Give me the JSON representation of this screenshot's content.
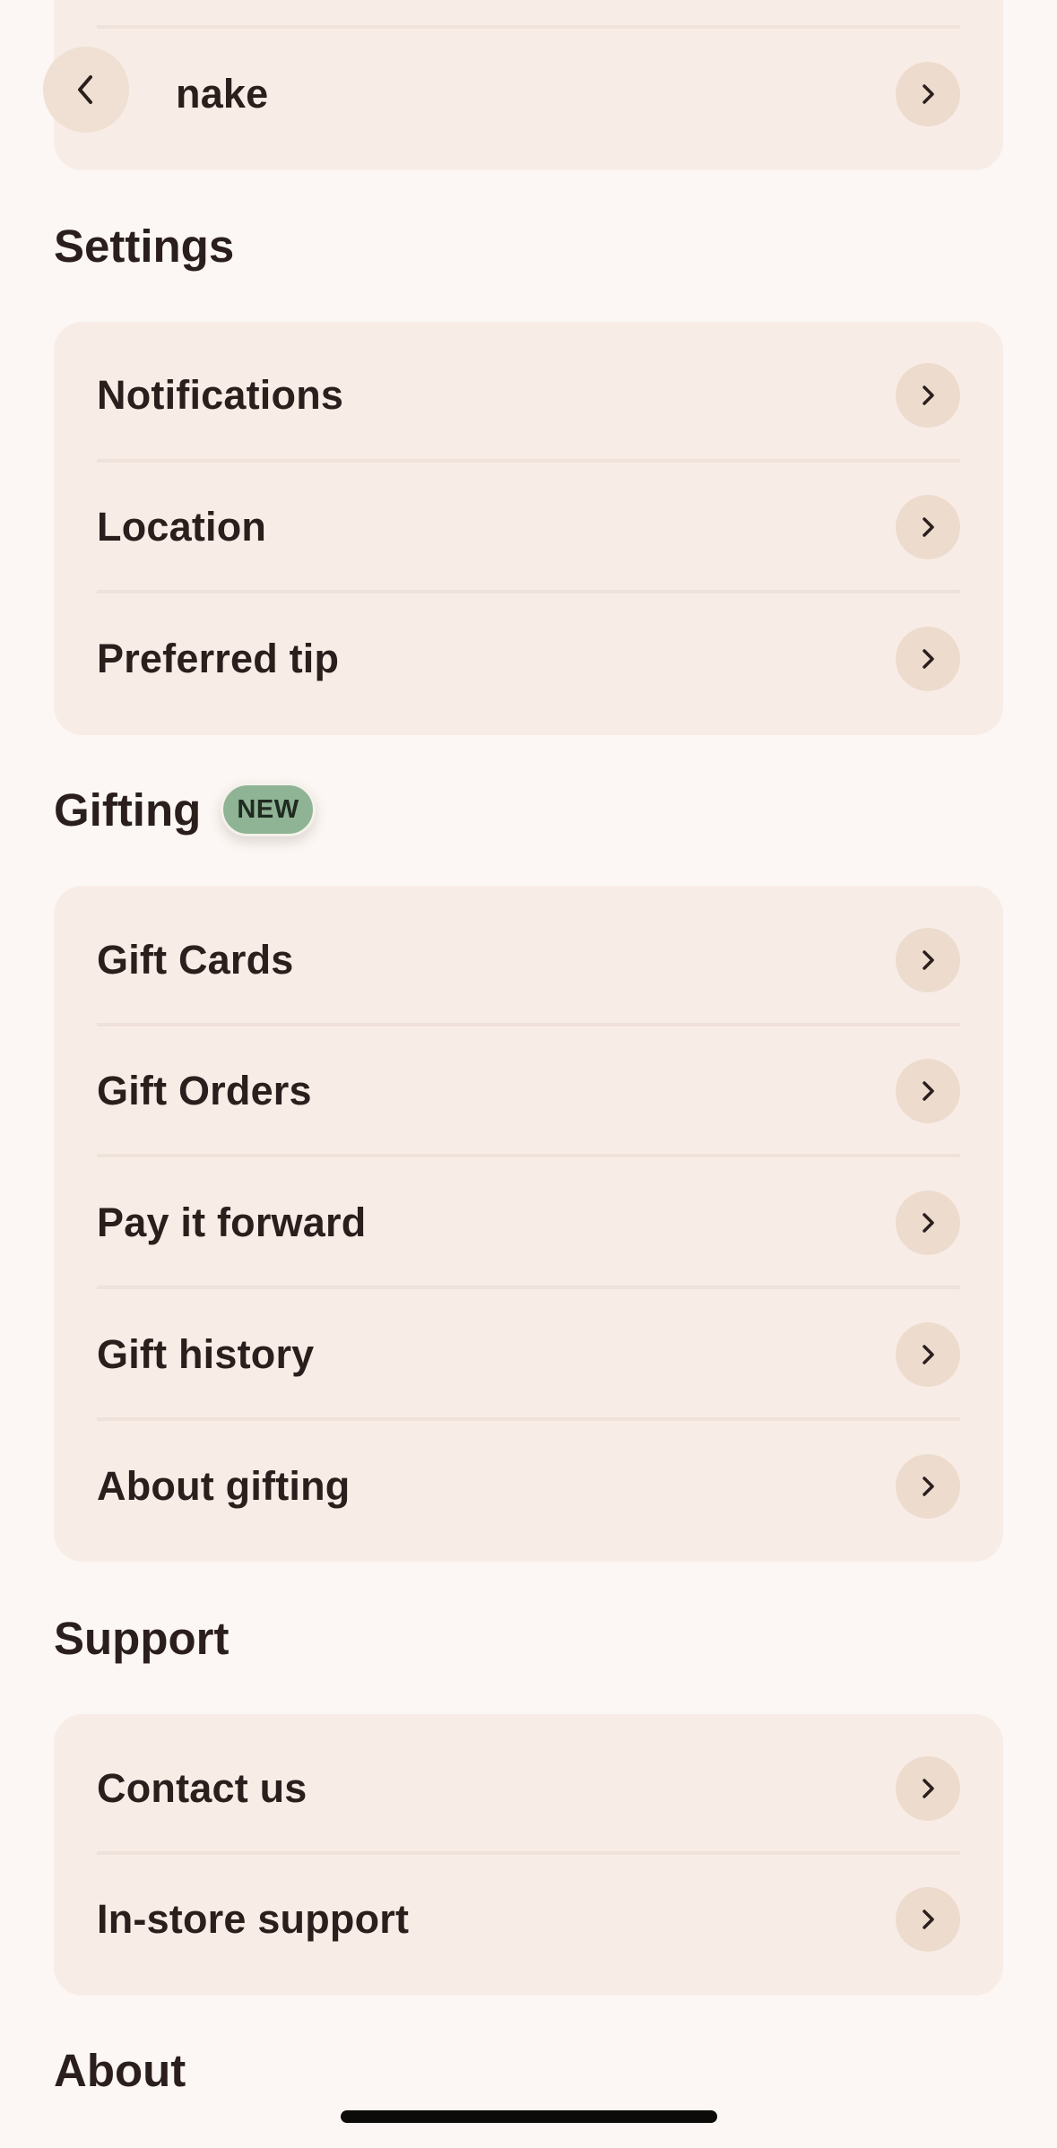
{
  "top_card": {
    "partial_label": "nake"
  },
  "settings": {
    "title": "Settings",
    "items": [
      {
        "label": "Notifications"
      },
      {
        "label": "Location"
      },
      {
        "label": "Preferred tip"
      }
    ]
  },
  "gifting": {
    "title": "Gifting",
    "badge": "NEW",
    "items": [
      {
        "label": "Gift Cards"
      },
      {
        "label": "Gift Orders"
      },
      {
        "label": "Pay it forward"
      },
      {
        "label": "Gift history"
      },
      {
        "label": "About gifting"
      }
    ]
  },
  "support": {
    "title": "Support",
    "items": [
      {
        "label": "Contact us"
      },
      {
        "label": "In-store support"
      }
    ]
  },
  "about": {
    "title": "About"
  },
  "icons": {
    "back": "chevron-left-icon",
    "row_chevron": "chevron-right-icon"
  },
  "colors": {
    "background": "#fcf7f4",
    "card": "#f8ede6",
    "chevron_circle": "#eddbce",
    "badge": "#8fb395",
    "text": "#2a1f1c"
  }
}
